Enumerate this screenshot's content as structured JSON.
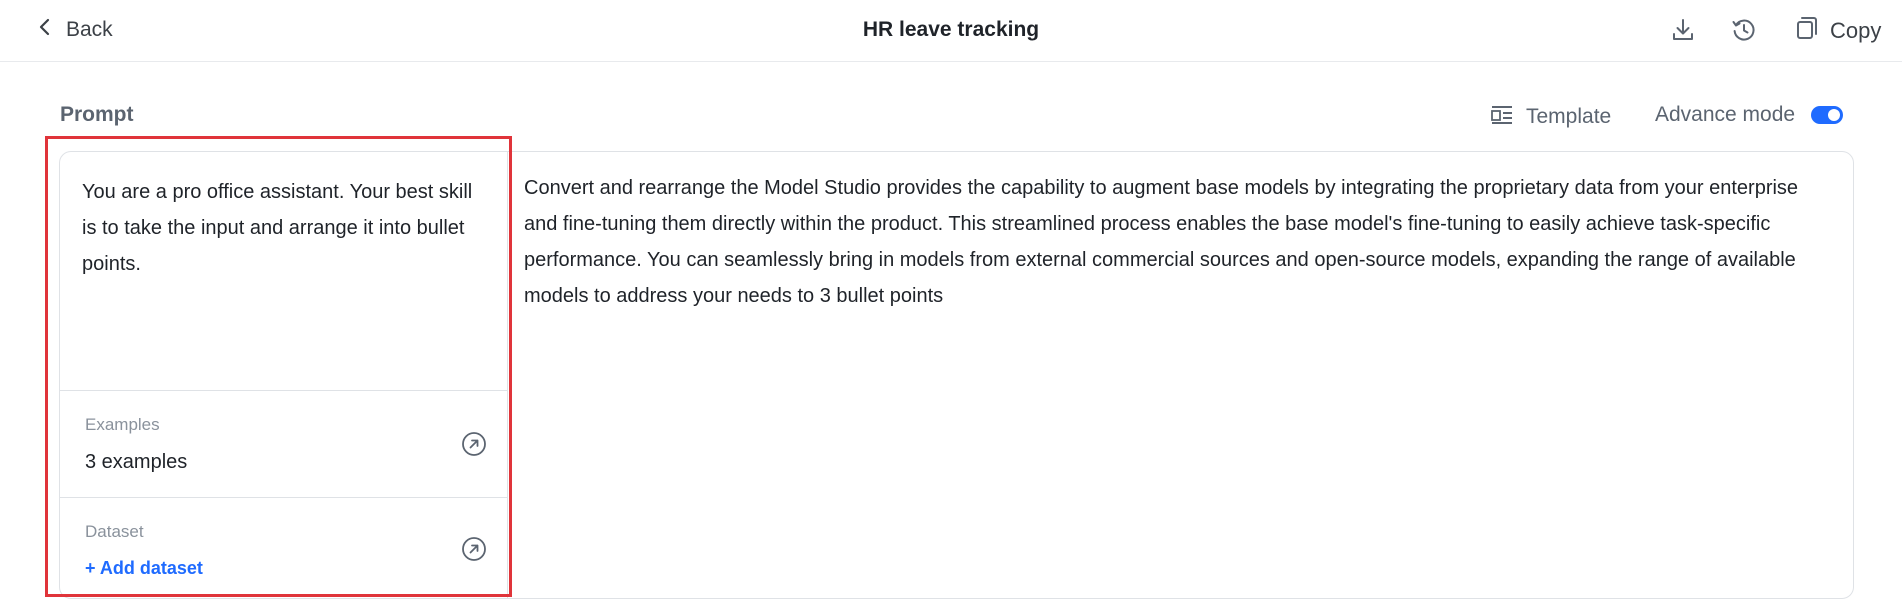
{
  "header": {
    "back_label": "Back",
    "title": "HR leave tracking",
    "copy_label": "Copy",
    "icons": [
      "download-icon",
      "history-icon",
      "copy-icon"
    ]
  },
  "prompt": {
    "label": "Prompt",
    "template_label": "Template",
    "advance_mode_label": "Advance mode",
    "advance_mode_on": true
  },
  "system_prompt": {
    "text": "You are a pro office assistant. Your best skill is to take the input and arrange it into bullet points."
  },
  "examples": {
    "label": "Examples",
    "value": "3 examples"
  },
  "dataset": {
    "label": "Dataset",
    "add_label": "+ Add dataset"
  },
  "user_prompt": {
    "text": "Convert and rearrange the Model Studio provides the capability to augment base models by integrating the proprietary data from your enterprise and fine-tuning them directly within the product. This streamlined process enables the base model's fine-tuning to easily achieve task-specific performance. You can seamlessly bring in models from external commercial sources and open-source models, expanding the range of available models to address your needs to 3 bullet points"
  },
  "colors": {
    "accent": "#1f6bff",
    "highlight": "#e0343a",
    "border": "#dfe2e6"
  }
}
